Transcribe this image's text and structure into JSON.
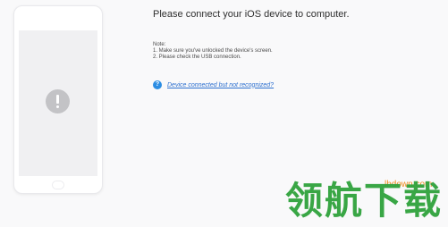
{
  "message": {
    "title": "Please connect your iOS device to computer.",
    "note_label": "Note:",
    "note_items": [
      "1. Make sure you've unlocked the device's screen.",
      "2. Please check the USB connection."
    ]
  },
  "help": {
    "icon": "question-icon",
    "icon_glyph": "?",
    "link_text": "Device connected but not recognized?"
  },
  "phone": {
    "status_icon": "exclamation-icon"
  },
  "watermark": {
    "site": "lhdown.com",
    "logo_text": "领航下载"
  },
  "colors": {
    "accent": "#2b8de3",
    "link": "#2c6fcf",
    "watermark_green": "#2fa23c",
    "watermark_orange": "#f08a1c"
  }
}
